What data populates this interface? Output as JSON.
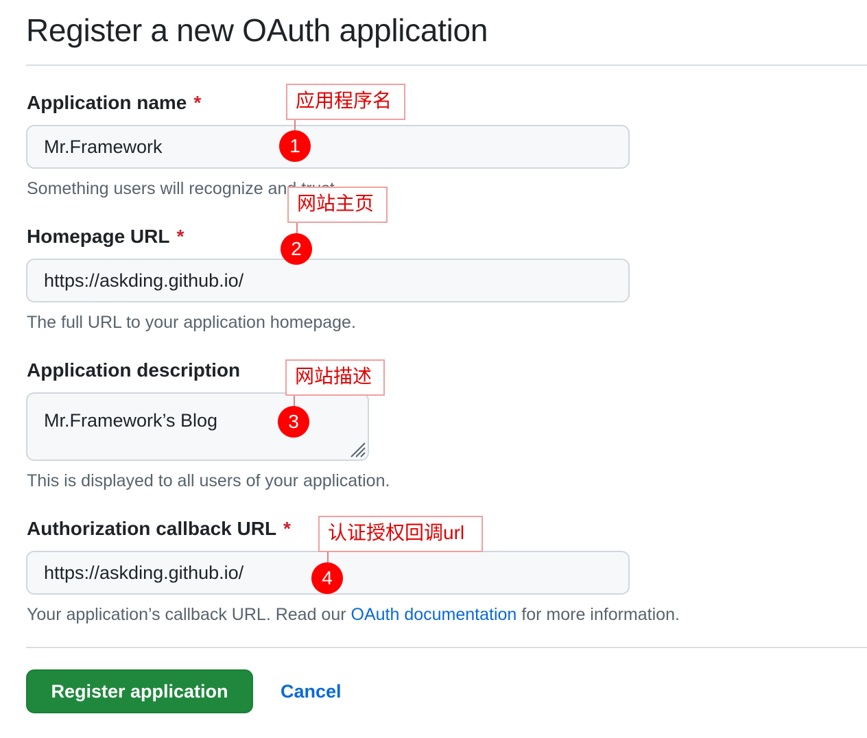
{
  "page_title": "Register a new OAuth application",
  "fields": [
    {
      "label": "Application name",
      "required_mark": "*",
      "value": "Mr.Framework",
      "hint": "Something users will recognize and trust."
    },
    {
      "label": "Homepage URL",
      "required_mark": "*",
      "value": "https://askding.github.io/",
      "hint": "The full URL to your application homepage."
    },
    {
      "label": "Application description",
      "value": "Mr.Framework’s Blog",
      "hint": "This is displayed to all users of your application."
    },
    {
      "label": "Authorization callback URL",
      "required_mark": "*",
      "value": "https://askding.github.io/",
      "hint_before": "Your application’s callback URL. Read our ",
      "hint_link": "OAuth documentation",
      "hint_after": " for more information."
    }
  ],
  "actions": {
    "submit_label": "Register application",
    "cancel_label": "Cancel"
  },
  "annotations": [
    {
      "number": "1",
      "text": "应用程序名"
    },
    {
      "number": "2",
      "text": "网站主页"
    },
    {
      "number": "3",
      "text": "网站描述"
    },
    {
      "number": "4",
      "text": "认证授权回调url"
    }
  ],
  "colors": {
    "primary_button": "#1f883d",
    "link": "#0969da",
    "required": "#cf222e",
    "annotation": "#ff0000"
  }
}
